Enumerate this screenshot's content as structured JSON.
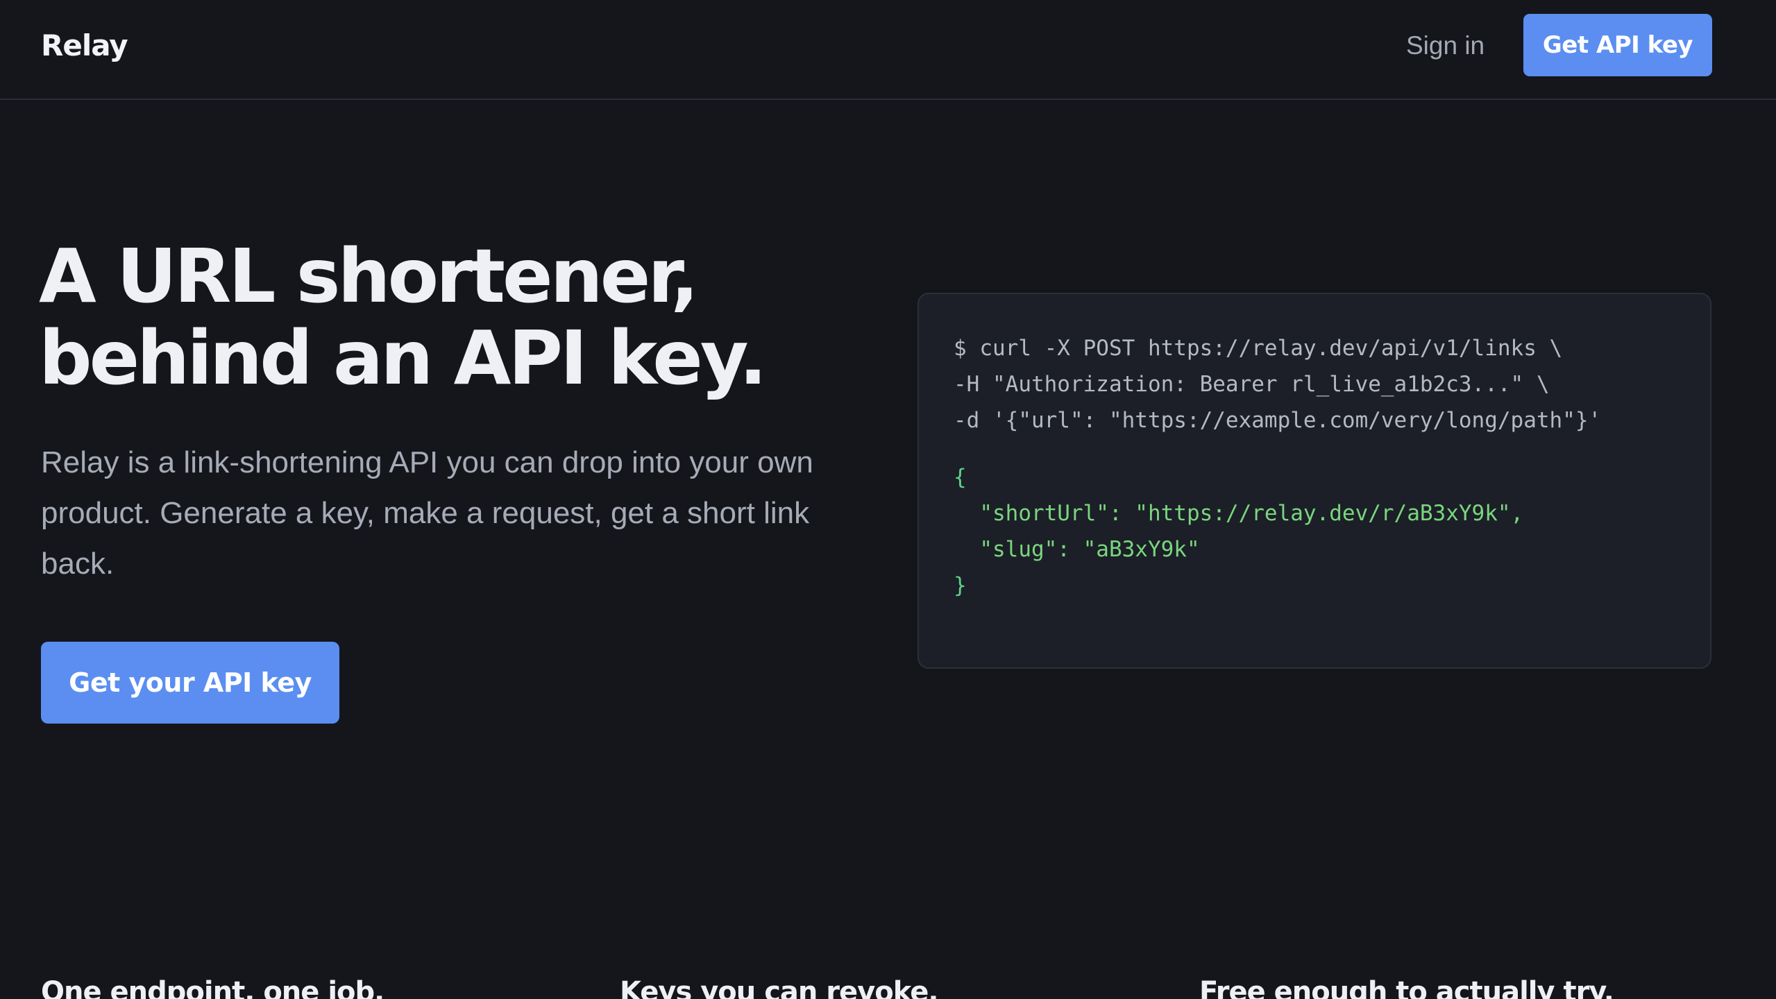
{
  "nav": {
    "brand": "Relay",
    "signin_label": "Sign in",
    "cta_label": "Get API key"
  },
  "hero": {
    "title_line1": "A URL shortener,",
    "title_line2": "behind an API key.",
    "subtitle": "Relay is a link-shortening API you can drop into your own product. Generate a key, make a request, get a short link back.",
    "cta_label": "Get your API key"
  },
  "code_example": {
    "command_lines": [
      "$ curl -X POST https://relay.dev/api/v1/links \\",
      "-H \"Authorization: Bearer rl_live_a1b2c3...\" \\",
      "-d '{\"url\": \"https://example.com/very/long/path\"}'"
    ],
    "response_lines": [
      "{",
      "  \"shortUrl\": \"https://relay.dev/r/aB3xY9k\",",
      "  \"slug\": \"aB3xY9k\"",
      "}"
    ]
  },
  "features": [
    {
      "title": "One endpoint, one job."
    },
    {
      "title": "Keys you can revoke."
    },
    {
      "title": "Free enough to actually try."
    }
  ],
  "colors": {
    "background": "#14161c",
    "accent": "#5b8ef0",
    "code_card": "#1c1f27",
    "json_green": "#5fd08a"
  }
}
